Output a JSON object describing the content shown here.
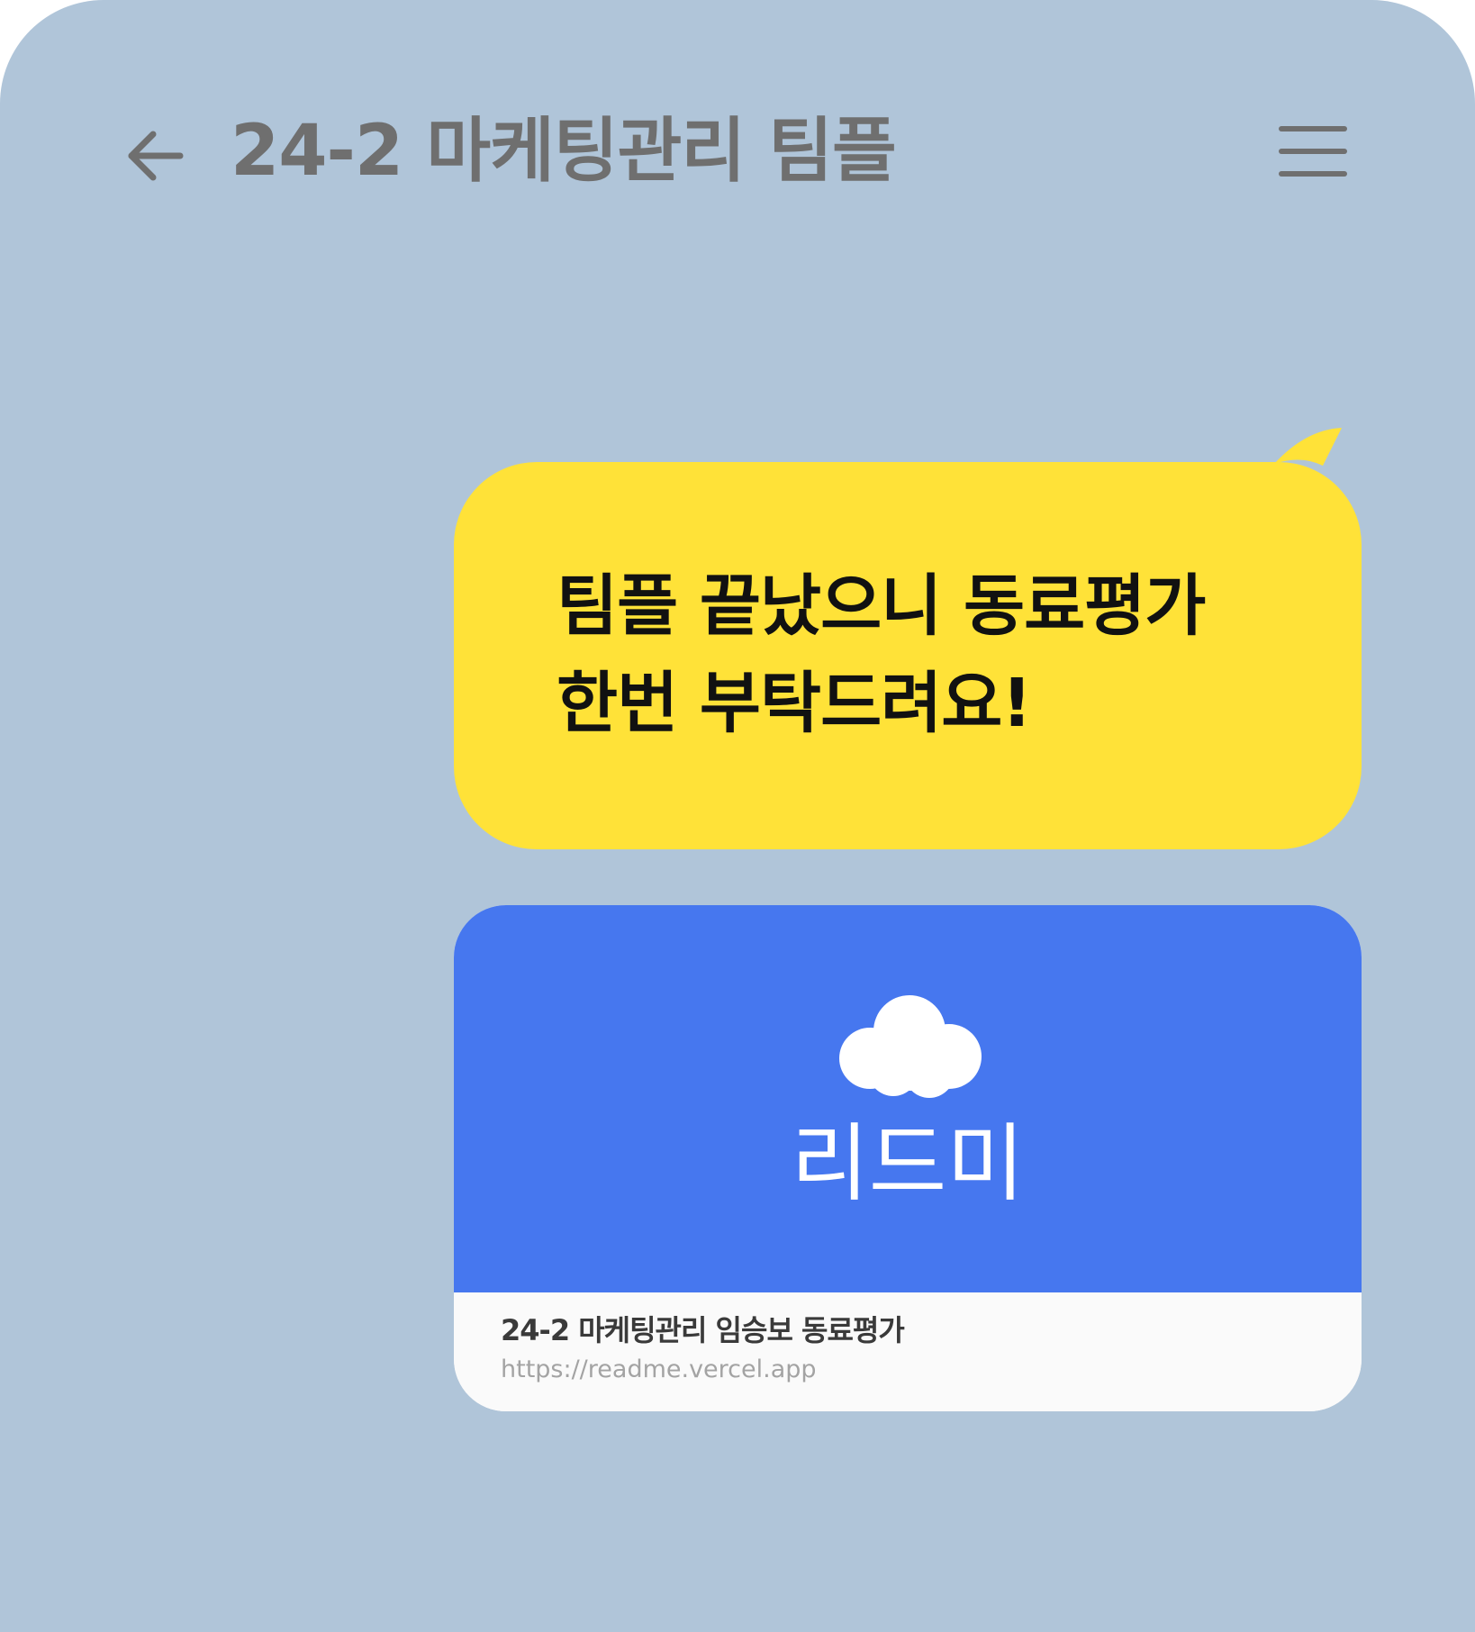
{
  "header": {
    "back_icon": "arrow-left-icon",
    "title": "24-2 마케팅관리 팀플",
    "menu_icon": "hamburger-menu-icon"
  },
  "message": {
    "lines": [
      "팀플 끝났으니 동료평가",
      "한번 부탁드려요!"
    ],
    "bubble_color": "#ffe238"
  },
  "link_preview": {
    "icon": "cloud-icon",
    "brand": "리드미",
    "hero_color": "#4677ef",
    "title": "24-2 마케팅관리 임승보 동료평가",
    "url": "https://readme.vercel.app"
  },
  "colors": {
    "background": "#b0c5d9",
    "header_text": "#6f6f6f"
  }
}
